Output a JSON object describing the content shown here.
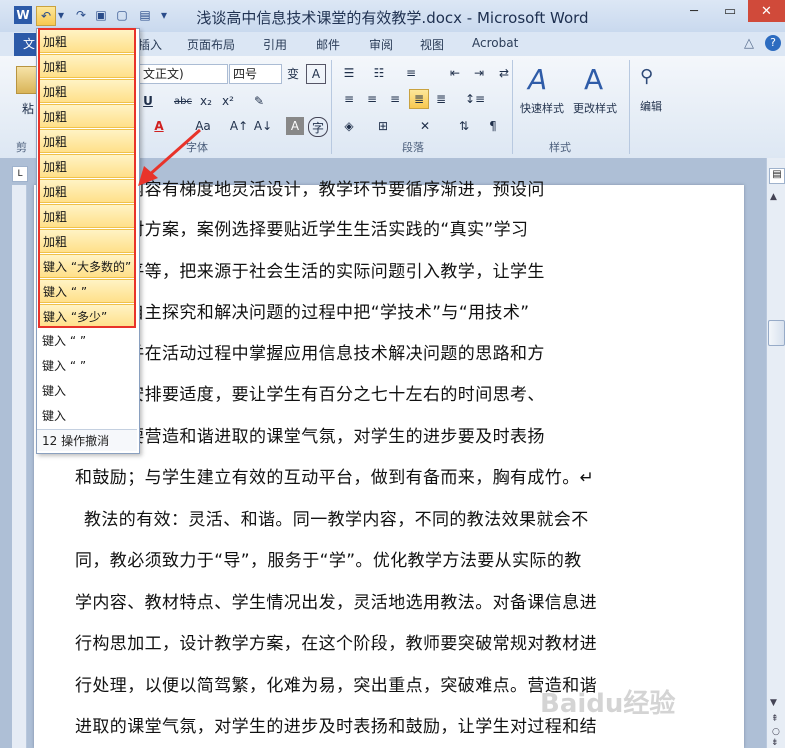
{
  "window": {
    "title": "浅谈高中信息技术课堂的有效教学.docx - Microsoft Word"
  },
  "quick_access": {
    "app_icon": "W",
    "undo_arrow": "▾"
  },
  "tabs": [
    {
      "label": "文",
      "active": true
    },
    {
      "label": "插入"
    },
    {
      "label": "页面布局"
    },
    {
      "label": "引用"
    },
    {
      "label": "邮件"
    },
    {
      "label": "审阅"
    },
    {
      "label": "视图"
    },
    {
      "label": "Acrobat"
    }
  ],
  "ribbon": {
    "clipboard_group": "剪",
    "paste_label": "粘",
    "font_name": "文正文)",
    "font_size": "四号",
    "font_group": "字体",
    "paragraph_group": "段落",
    "styles_group": "样式",
    "quick_styles": "快速样式",
    "change_styles": "更改样式",
    "edit_label": "编辑"
  },
  "undo_list": {
    "items": [
      {
        "label": "加粗",
        "selected": true
      },
      {
        "label": "加粗",
        "selected": true
      },
      {
        "label": "加粗",
        "selected": true
      },
      {
        "label": "加粗",
        "selected": true
      },
      {
        "label": "加粗",
        "selected": true
      },
      {
        "label": "加粗",
        "selected": true
      },
      {
        "label": "加粗",
        "selected": true
      },
      {
        "label": "加粗",
        "selected": true
      },
      {
        "label": "加粗",
        "selected": true
      },
      {
        "label": "键入 “大多数的”",
        "selected": true
      },
      {
        "label": "键入 “ ”",
        "selected": true
      },
      {
        "label": "键入 “多少”",
        "selected": true
      },
      {
        "label": "键入 “ ”",
        "selected": false
      },
      {
        "label": "键入 “ ”",
        "selected": false
      },
      {
        "label": "键入",
        "selected": false
      },
      {
        "label": "键入",
        "selected": false
      }
    ],
    "footer": "12 操作撤消"
  },
  "document": {
    "lines": [
      "和认知内容有梯度地灵活设计，教学环节要循序渐进，预设问",
      "多个应对方案，案例选择要贴近学生生活实践的“真实”学习",
      "技能水平等，把来源于社会生活的实际问题引入教学，让学生",
      "操作、自主探究和解决问题的过程中把“学技术”与“用技术”",
      "一起，并在活动过程中掌握应用信息技术解决问题的思路和方",
      "时间的安排要适度，要让学生有百分之七十左右的时间思考、",
      "探索。要营造和谐进取的课堂气氛，对学生的进步要及时表扬",
      "和鼓励；与学生建立有效的互动平台，做到有备而来，胸有成竹。↵",
      "教法的有效：灵活、和谐。同一教学内容，不同的教法效果就会不",
      "同，教必须致力于“导”，服务于“学”。优化教学方法要从实际的教",
      "学内容、教材特点、学生情况出发，灵活地选用教法。对备课信息进",
      "行构思加工，设计教学方案，在这个阶段，教师要突破常规对教材进",
      "行处理，以便以简驾繁，化难为易，突出重点，突破难点。营造和谐",
      "进取的课堂气氛，对学生的进步及时表扬和鼓励，让学生对过程和结"
    ]
  },
  "watermark": "Baidu经验"
}
